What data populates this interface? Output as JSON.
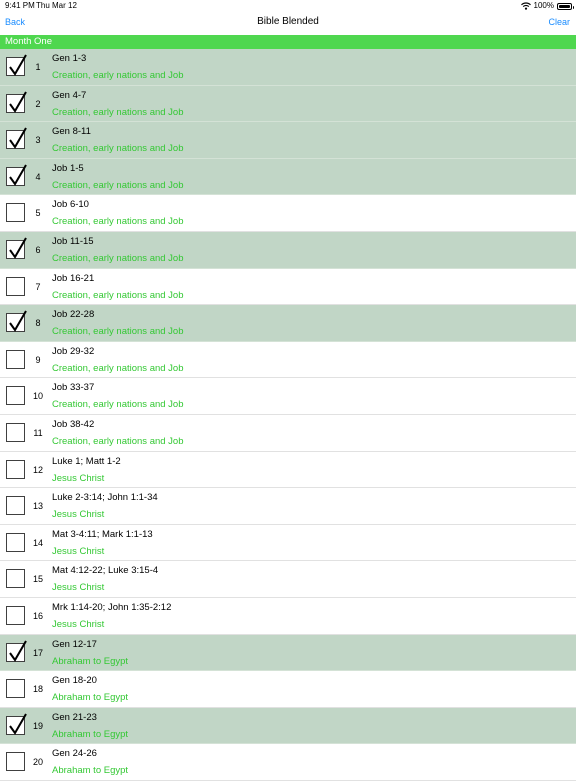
{
  "status": {
    "time": "9:41 PM",
    "date": "Thu Mar 12",
    "battery": "100%",
    "battery_level": 1.0
  },
  "nav": {
    "back_label": "Back",
    "title": "Bible Blended",
    "clear_label": "Clear"
  },
  "section": {
    "title": "Month One"
  },
  "rows": [
    {
      "day": "1",
      "reading": "Gen 1-3",
      "theme": "Creation, early nations and Job",
      "checked": true
    },
    {
      "day": "2",
      "reading": "Gen 4-7",
      "theme": "Creation, early nations and Job",
      "checked": true
    },
    {
      "day": "3",
      "reading": "Gen 8-11",
      "theme": "Creation, early nations and Job",
      "checked": true
    },
    {
      "day": "4",
      "reading": "Job 1-5",
      "theme": "Creation, early nations and Job",
      "checked": true
    },
    {
      "day": "5",
      "reading": "Job 6-10",
      "theme": "Creation, early nations and Job",
      "checked": false
    },
    {
      "day": "6",
      "reading": "Job 11-15",
      "theme": "Creation, early nations and Job",
      "checked": true
    },
    {
      "day": "7",
      "reading": "Job 16-21",
      "theme": "Creation, early nations and Job",
      "checked": false
    },
    {
      "day": "8",
      "reading": "Job 22-28",
      "theme": "Creation, early nations and Job",
      "checked": true
    },
    {
      "day": "9",
      "reading": "Job 29-32",
      "theme": "Creation, early nations and Job",
      "checked": false
    },
    {
      "day": "10",
      "reading": "Job 33-37",
      "theme": "Creation, early nations and Job",
      "checked": false
    },
    {
      "day": "11",
      "reading": "Job 38-42",
      "theme": "Creation, early nations and Job",
      "checked": false
    },
    {
      "day": "12",
      "reading": "Luke 1; Matt 1-2",
      "theme": "Jesus Christ",
      "checked": false
    },
    {
      "day": "13",
      "reading": "Luke 2-3:14; John 1:1-34",
      "theme": "Jesus Christ",
      "checked": false
    },
    {
      "day": "14",
      "reading": "Mat 3-4:11; Mark 1:1-13",
      "theme": "Jesus Christ",
      "checked": false
    },
    {
      "day": "15",
      "reading": "Mat 4:12-22; Luke 3:15-4",
      "theme": "Jesus Christ",
      "checked": false
    },
    {
      "day": "16",
      "reading": "Mrk 1:14-20; John 1:35-2:12",
      "theme": "Jesus Christ",
      "checked": false
    },
    {
      "day": "17",
      "reading": "Gen 12-17",
      "theme": "Abraham to Egypt",
      "checked": true
    },
    {
      "day": "18",
      "reading": "Gen 18-20",
      "theme": "Abraham to Egypt",
      "checked": false
    },
    {
      "day": "19",
      "reading": "Gen 21-23",
      "theme": "Abraham to Egypt",
      "checked": true
    },
    {
      "day": "20",
      "reading": "Gen 24-26",
      "theme": "Abraham to Egypt",
      "checked": false
    }
  ],
  "icons": {
    "checkmark": "checkmark-icon",
    "wifi": "wifi-icon",
    "battery": "battery-icon"
  },
  "colors": {
    "accent_blue": "#1a8cff",
    "section_green": "#4fd74f",
    "theme_green": "#34c834",
    "completed_row_bg": "#c1d6c6"
  }
}
